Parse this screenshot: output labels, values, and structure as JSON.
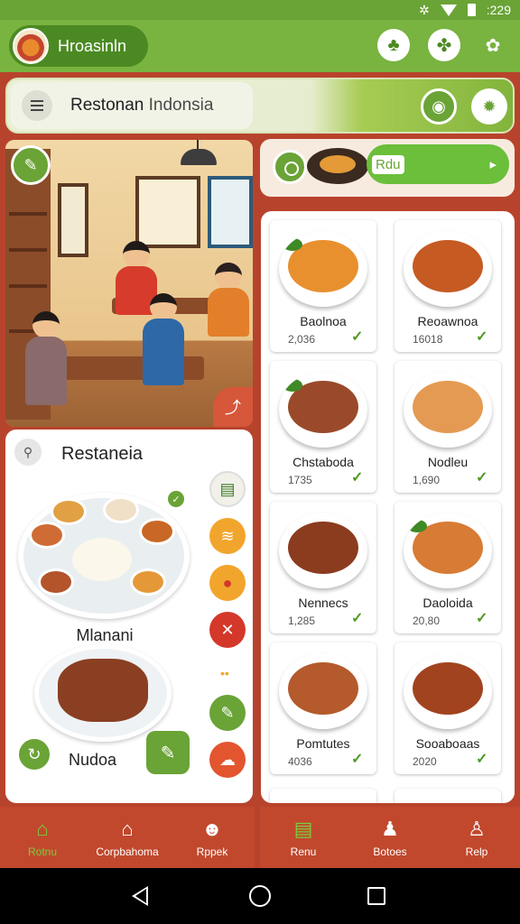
{
  "status": {
    "time": ":229"
  },
  "header": {
    "app_name": "Hroasinln",
    "icons": [
      "leaf-icon",
      "clover-icon",
      "flower-icon"
    ]
  },
  "search": {
    "label_main": "Restonan",
    "label_sub": "Indonsia"
  },
  "banner": {
    "label": "Rdu"
  },
  "left_card": {
    "title": "Restaneia",
    "dish1_name": "Mlanani",
    "dish2_name": "Nudoa"
  },
  "menu": [
    {
      "name": "Baolnoa",
      "price": "2,036",
      "color": "#e8902e"
    },
    {
      "name": "Reoawnoa",
      "price": "16018",
      "color": "#c65a23"
    },
    {
      "name": "Chstaboda",
      "price": "1735",
      "color": "#9a4a2a"
    },
    {
      "name": "Nodleu",
      "price": "1,690",
      "color": "#e49a52"
    },
    {
      "name": "Nennecs",
      "price": "1,285",
      "color": "#8b3b1e"
    },
    {
      "name": "Daoloida",
      "price": "20,80",
      "color": "#d77b35"
    },
    {
      "name": "Pomtutes",
      "price": "4036",
      "color": "#b45a2c"
    },
    {
      "name": "Sooaboaas",
      "price": "2020",
      "color": "#a2431f"
    }
  ],
  "bottom_nav_left": [
    {
      "label": "Rotnu",
      "icon": "home-icon",
      "active": true
    },
    {
      "label": "Corpbahoma",
      "icon": "store-icon",
      "active": false
    },
    {
      "label": "Rppek",
      "icon": "chat-icon",
      "active": false
    }
  ],
  "bottom_nav_right": [
    {
      "label": "Renu",
      "icon": "menu-board-icon",
      "active": false
    },
    {
      "label": "Botoes",
      "icon": "people-icon",
      "active": false
    },
    {
      "label": "Relp",
      "icon": "profile-icon",
      "active": false
    }
  ],
  "colors": {
    "primary_green": "#6aa336",
    "accent_red": "#c1482d"
  }
}
